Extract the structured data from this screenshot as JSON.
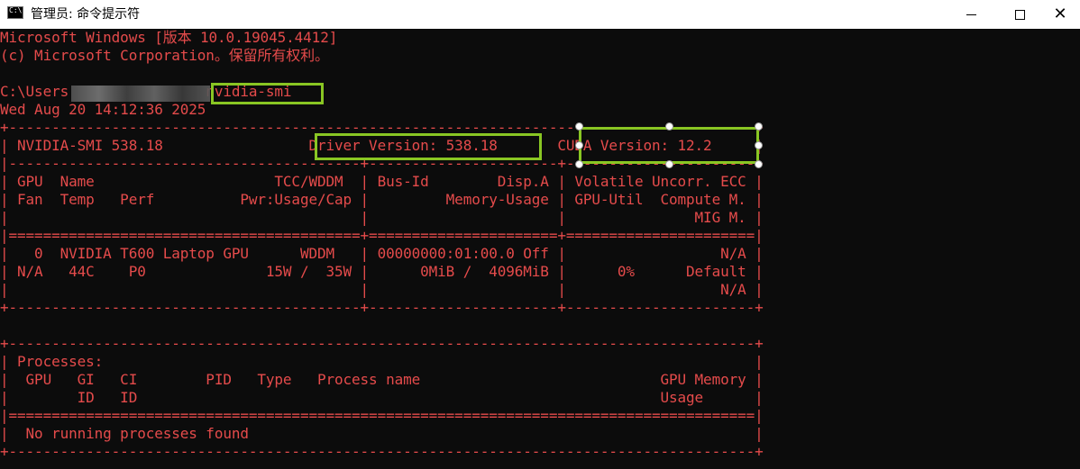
{
  "window": {
    "title": "管理员: 命令提示符",
    "icon_label": "C:\\",
    "minimize_glyph": "—",
    "maximize_glyph": "☐",
    "close_glyph": "✕"
  },
  "colors": {
    "text": "#e54b4b",
    "background": "#0c0c0c",
    "highlight": "#89c623"
  },
  "console": {
    "lines": [
      "Microsoft Windows [版本 10.0.19045.4412]",
      "(c) Microsoft Corporation。保留所有权利。",
      "",
      "C:\\Users                nvidia-smi",
      "Wed Aug 20 14:12:36 2025",
      "+---------------------------------------------------------------------------------------+",
      "| NVIDIA-SMI 538.18                 Driver Version: 538.18       CUDA Version: 12.2     |",
      "|-----------------------------------------+----------------------+----------------------+",
      "| GPU  Name                     TCC/WDDM  | Bus-Id        Disp.A | Volatile Uncorr. ECC |",
      "| Fan  Temp   Perf          Pwr:Usage/Cap |         Memory-Usage | GPU-Util  Compute M. |",
      "|                                         |                      |               MIG M. |",
      "|=========================================+======================+======================|",
      "|   0  NVIDIA T600 Laptop GPU      WDDM   | 00000000:01:00.0 Off |                  N/A |",
      "| N/A   44C    P0              15W /  35W |      0MiB /  4096MiB |      0%      Default |",
      "|                                         |                      |                  N/A |",
      "+-----------------------------------------+----------------------+----------------------+",
      "",
      "+---------------------------------------------------------------------------------------+",
      "| Processes:                                                                            |",
      "|  GPU   GI   CI        PID   Type   Process name                            GPU Memory |",
      "|        ID   ID                                                             Usage      |",
      "|=======================================================================================|",
      "|  No running processes found                                                           |",
      "+---------------------------------------------------------------------------------------+"
    ]
  }
}
